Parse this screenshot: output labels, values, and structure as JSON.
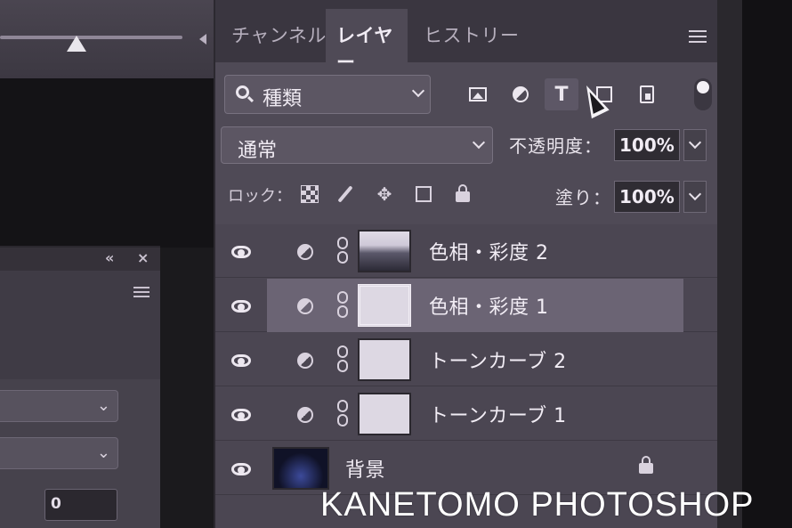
{
  "tabs": [
    {
      "label": "チャンネル",
      "active": false
    },
    {
      "label": "レイヤー",
      "active": true
    },
    {
      "label": "ヒストリー",
      "active": false
    }
  ],
  "filter": {
    "kind_label": "種類",
    "icons": [
      "image-filter-icon",
      "adjustment-filter-icon",
      "type-filter-icon",
      "shape-filter-icon",
      "smart-object-filter-icon"
    ],
    "active_icon": "type-filter-icon"
  },
  "blend": {
    "mode": "通常",
    "opacity_label": "不透明度：",
    "opacity_value": "100%"
  },
  "lock": {
    "label": "ロック：",
    "fill_label": "塗り：",
    "fill_value": "100%"
  },
  "layers": [
    {
      "name": "色相・彩度 2",
      "type": "adjustment",
      "thumb": "photo",
      "selected": false
    },
    {
      "name": "色相・彩度 1",
      "type": "adjustment",
      "thumb": "white",
      "selected": true
    },
    {
      "name": "トーンカーブ 2",
      "type": "adjustment",
      "thumb": "white",
      "selected": false
    },
    {
      "name": "トーンカーブ 1",
      "type": "adjustment",
      "thumb": "white",
      "selected": false
    },
    {
      "name": "背景",
      "type": "background",
      "thumb": "night",
      "selected": false,
      "locked": true
    }
  ],
  "background_panel": {
    "number_value": "0"
  },
  "watermark": "KANETOMO PHOTOSHOP",
  "colors": {
    "panel_bg": "#4f4a56",
    "tab_bar_bg": "#3a3640",
    "selected_row": "#6b6474"
  }
}
